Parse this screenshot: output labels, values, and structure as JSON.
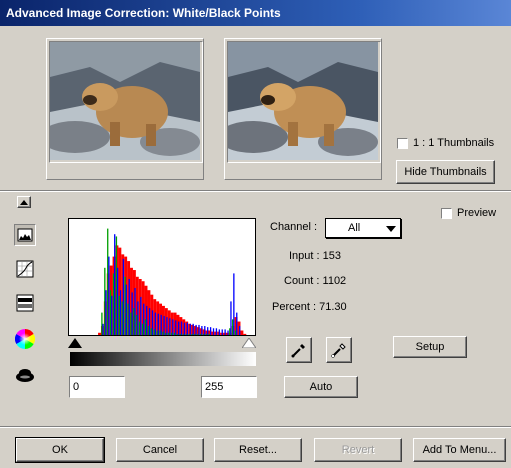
{
  "window": {
    "title": "Advanced Image Correction: White/Black Points"
  },
  "thumbnails": {
    "one_to_one_label": "1 : 1 Thumbnails",
    "one_to_one_checked": false,
    "hide_button": "Hide Thumbnails"
  },
  "preview": {
    "label": "Preview",
    "checked": false
  },
  "channel": {
    "label": "Channel :",
    "selected": "All"
  },
  "readouts": {
    "input": "Input : 153",
    "count": "Count : 1102",
    "percent": "Percent : 71.30"
  },
  "levels": {
    "black_point": "0",
    "white_point": "255"
  },
  "buttons": {
    "setup": "Setup",
    "auto": "Auto",
    "ok": "OK",
    "cancel": "Cancel",
    "reset": "Reset...",
    "revert": "Revert",
    "add_to_menu": "Add To Menu..."
  },
  "tools": [
    "collapse-arrow-icon",
    "histogram-tool-icon",
    "curves-tool-icon",
    "levels-tool-icon",
    "color-wheel-icon",
    "hat-tool-icon"
  ],
  "chart_data": {
    "type": "area",
    "description_series": [
      "red",
      "green",
      "blue"
    ],
    "x_range": [
      0,
      255
    ],
    "series": [
      {
        "color": "#ff0000",
        "values": [
          0,
          0,
          0,
          0,
          0,
          0,
          0,
          0,
          0,
          0,
          2,
          8,
          30,
          55,
          62,
          70,
          80,
          78,
          72,
          70,
          66,
          60,
          58,
          52,
          50,
          48,
          44,
          40,
          36,
          32,
          30,
          28,
          26,
          24,
          22,
          20,
          20,
          18,
          16,
          14,
          12,
          10,
          9,
          8,
          7,
          6,
          5,
          4,
          4,
          3,
          3,
          3,
          2,
          2,
          2,
          2,
          8,
          16,
          12,
          4,
          1,
          0,
          0,
          0
        ]
      },
      {
        "color": "#00a000",
        "values": [
          0,
          0,
          0,
          0,
          0,
          0,
          0,
          0,
          0,
          0,
          0,
          20,
          60,
          95,
          40,
          55,
          88,
          35,
          30,
          52,
          28,
          20,
          24,
          18,
          12,
          10,
          14,
          8,
          6,
          5,
          4,
          4,
          3,
          2,
          2,
          2,
          2,
          1,
          1,
          1,
          1,
          1,
          1,
          1,
          1,
          1,
          1,
          1,
          1,
          0,
          0,
          0,
          0,
          0,
          0,
          6,
          14,
          4,
          0,
          0,
          0,
          0,
          0,
          0
        ]
      },
      {
        "color": "#0000ff",
        "values": [
          0,
          0,
          0,
          0,
          0,
          0,
          0,
          0,
          0,
          0,
          0,
          10,
          40,
          70,
          35,
          90,
          60,
          40,
          68,
          45,
          50,
          38,
          42,
          30,
          34,
          28,
          26,
          24,
          22,
          20,
          19,
          18,
          17,
          16,
          15,
          14,
          13,
          12,
          12,
          11,
          11,
          10,
          10,
          9,
          9,
          8,
          8,
          7,
          7,
          6,
          6,
          5,
          5,
          5,
          4,
          30,
          55,
          20,
          8,
          0,
          0,
          0,
          0,
          0
        ]
      }
    ],
    "colors": {
      "red": "#ff0000",
      "green": "#00a000",
      "blue": "#0000ff"
    }
  }
}
